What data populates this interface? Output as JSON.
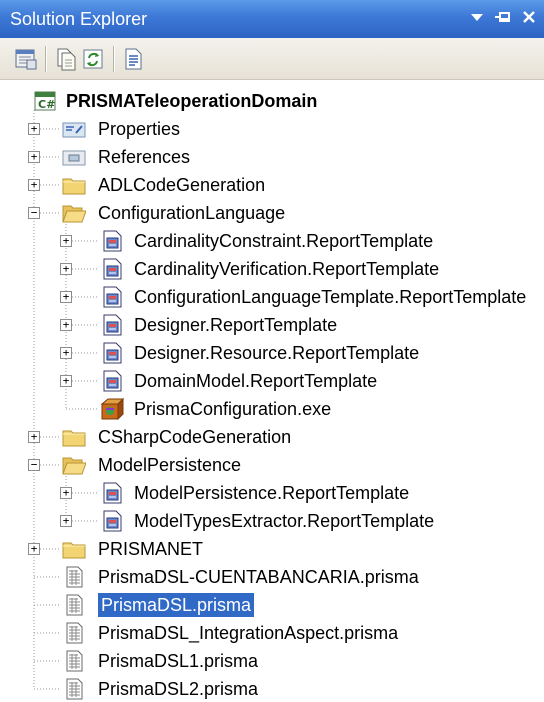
{
  "window": {
    "title": "Solution Explorer",
    "controls": [
      "dropdown-icon",
      "pin-icon",
      "close-icon"
    ]
  },
  "toolbar": {
    "buttons": [
      "properties-icon",
      "show-all-files-icon",
      "refresh-icon",
      "view-code-icon"
    ]
  },
  "tree": {
    "project": {
      "label": "PRISMATeleoperationDomain",
      "icon": "csharp-project-icon"
    },
    "items": [
      {
        "label": "Properties",
        "icon": "properties-folder-icon",
        "expander": "+"
      },
      {
        "label": "References",
        "icon": "references-icon",
        "expander": "+"
      },
      {
        "label": "ADLCodeGeneration",
        "icon": "folder-icon",
        "expander": "+"
      },
      {
        "label": "ConfigurationLanguage",
        "icon": "open-folder-icon",
        "expander": "-"
      },
      {
        "label": "CardinalityConstraint.ReportTemplate",
        "icon": "report-template-icon",
        "expander": "+"
      },
      {
        "label": "CardinalityVerification.ReportTemplate",
        "icon": "report-template-icon",
        "expander": "+"
      },
      {
        "label": "ConfigurationLanguageTemplate.ReportTemplate",
        "icon": "report-template-icon",
        "expander": "+"
      },
      {
        "label": "Designer.ReportTemplate",
        "icon": "report-template-icon",
        "expander": "+"
      },
      {
        "label": "Designer.Resource.ReportTemplate",
        "icon": "report-template-icon",
        "expander": "+"
      },
      {
        "label": "DomainModel.ReportTemplate",
        "icon": "report-template-icon",
        "expander": "+"
      },
      {
        "label": "PrismaConfiguration.exe",
        "icon": "exe-icon",
        "expander": ""
      },
      {
        "label": "CSharpCodeGeneration",
        "icon": "folder-icon",
        "expander": "+"
      },
      {
        "label": "ModelPersistence",
        "icon": "open-folder-icon",
        "expander": "-"
      },
      {
        "label": "ModelPersistence.ReportTemplate",
        "icon": "report-template-icon",
        "expander": "+"
      },
      {
        "label": "ModelTypesExtractor.ReportTemplate",
        "icon": "report-template-icon",
        "expander": "+"
      },
      {
        "label": "PRISMANET",
        "icon": "folder-icon",
        "expander": "+"
      },
      {
        "label": "PrismaDSL-CUENTABANCARIA.prisma",
        "icon": "prisma-file-icon",
        "expander": ""
      },
      {
        "label": "PrismaDSL.prisma",
        "icon": "prisma-file-icon",
        "expander": "",
        "selected": true
      },
      {
        "label": "PrismaDSL_IntegrationAspect.prisma",
        "icon": "prisma-file-icon",
        "expander": ""
      },
      {
        "label": "PrismaDSL1.prisma",
        "icon": "prisma-file-icon",
        "expander": ""
      },
      {
        "label": "PrismaDSL2.prisma",
        "icon": "prisma-file-icon",
        "expander": ""
      }
    ]
  },
  "colors": {
    "title_bar": "#3d78d6",
    "selection": "#3169c6",
    "folder": "#f2d572"
  }
}
